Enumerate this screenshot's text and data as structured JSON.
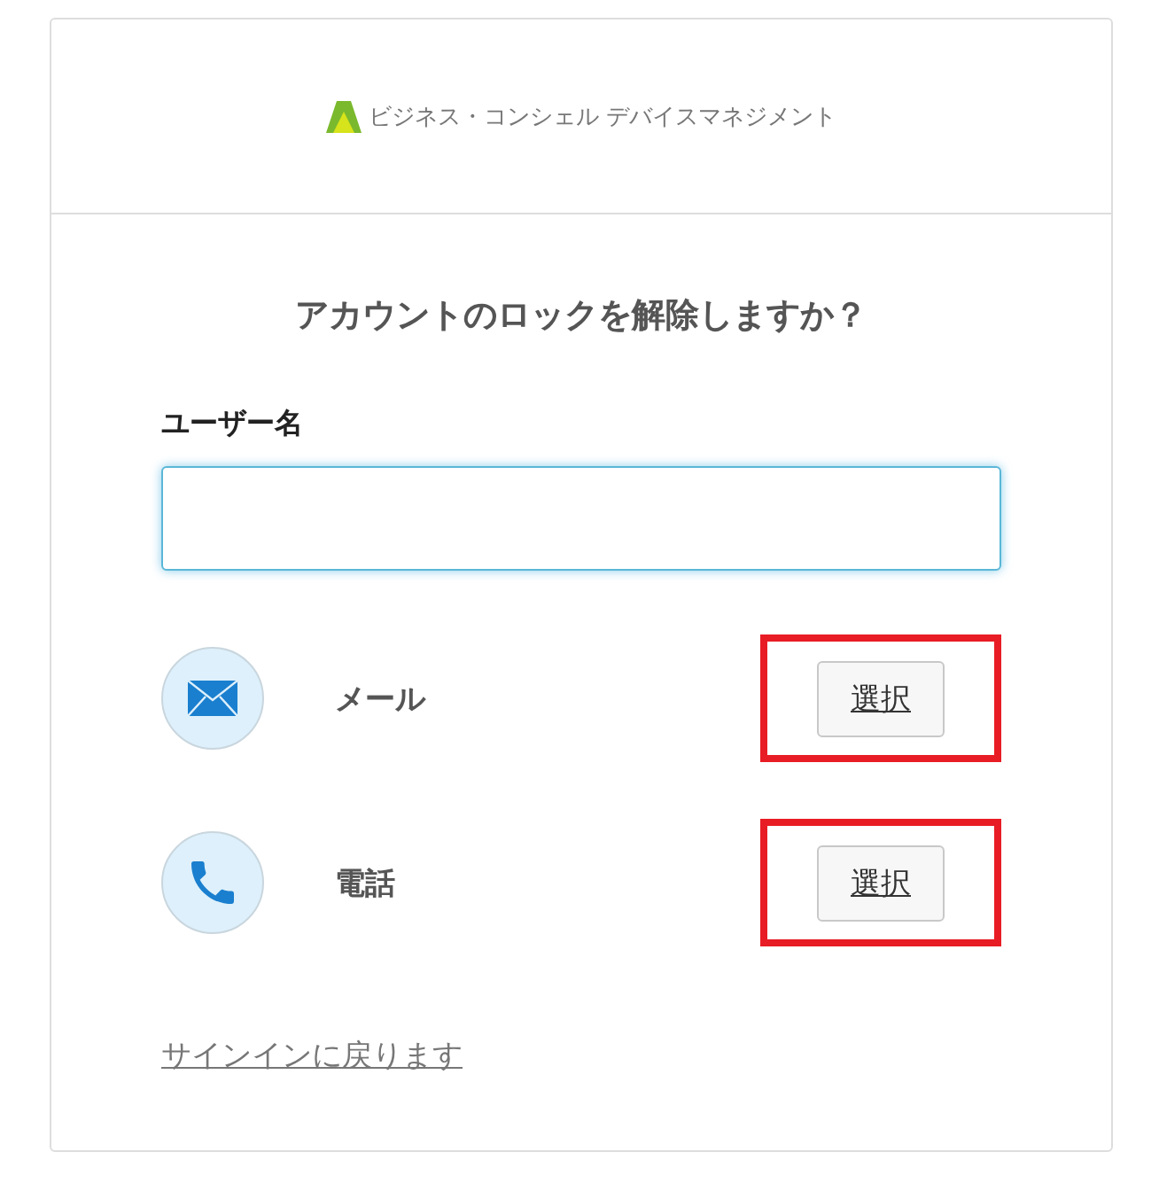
{
  "header": {
    "brand": "ビジネス・コンシェル デバイスマネジメント"
  },
  "title": "アカウントのロックを解除しますか？",
  "username": {
    "label": "ユーザー名",
    "focused": true
  },
  "methods": [
    {
      "kind": "mail",
      "label": "メール",
      "button": "選択",
      "highlighted": true
    },
    {
      "kind": "phone",
      "label": "電話",
      "button": "選択",
      "highlighted": true
    }
  ],
  "back_link": "サインインに戻ります"
}
